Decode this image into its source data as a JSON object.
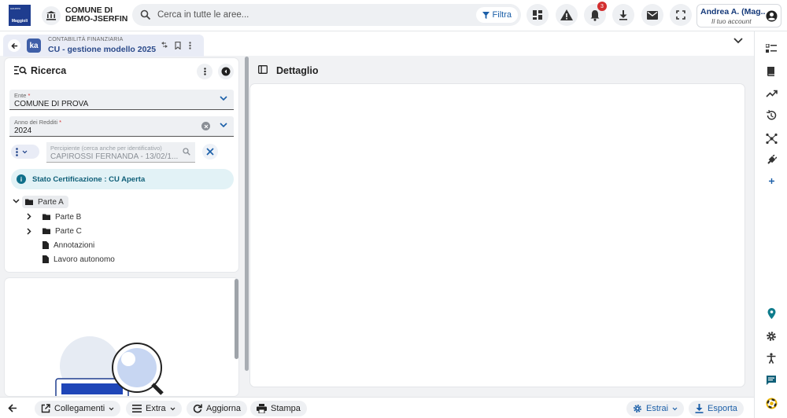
{
  "header": {
    "comune_line1": "COMUNE DI",
    "comune_line2": "DEMO-JSERFIN",
    "search_placeholder": "Cerca in tutte le aree...",
    "filter_label": "Filtra",
    "notification_count": "3",
    "user_name": "Andrea A. (Mag...",
    "user_account": "Il tuo account"
  },
  "tab": {
    "supertitle": "CONTABILITÀ FINANZIARIA",
    "title": "CU - gestione modello 2025"
  },
  "ricerca": {
    "title": "Ricerca",
    "ente": {
      "label": "Ente",
      "required_mark": "*",
      "value": "COMUNE DI PROVA"
    },
    "anno": {
      "label": "Anno dei Redditi",
      "required_mark": "*",
      "value": "2024"
    },
    "percipiente": {
      "label": "Percipiente (cerca anche per identificativo)",
      "value": "CAPIROSSI FERNANDA - 13/02/1..."
    },
    "status": "Stato Certificazione : CU Aperta",
    "tree": [
      {
        "label": "Parte A",
        "expanded": true,
        "folder": true
      },
      {
        "label": "Parte B",
        "expanded": false,
        "folder": true
      },
      {
        "label": "Parte C",
        "expanded": false,
        "folder": true
      },
      {
        "label": "Annotazioni",
        "folder": false
      },
      {
        "label": "Lavoro autonomo",
        "folder": false
      }
    ]
  },
  "detail": {
    "title": "Dettaglio"
  },
  "bottombar": {
    "collegamenti": "Collegamenti",
    "extra": "Extra",
    "aggiorna": "Aggiorna",
    "stampa": "Stampa",
    "estrai": "Estrai",
    "esporta": "Esporta"
  },
  "colors": {
    "accent": "#1b5fa8",
    "brand": "#1f3d8f",
    "status_bg": "#e2f2f6",
    "badge": "#d32f2f"
  }
}
